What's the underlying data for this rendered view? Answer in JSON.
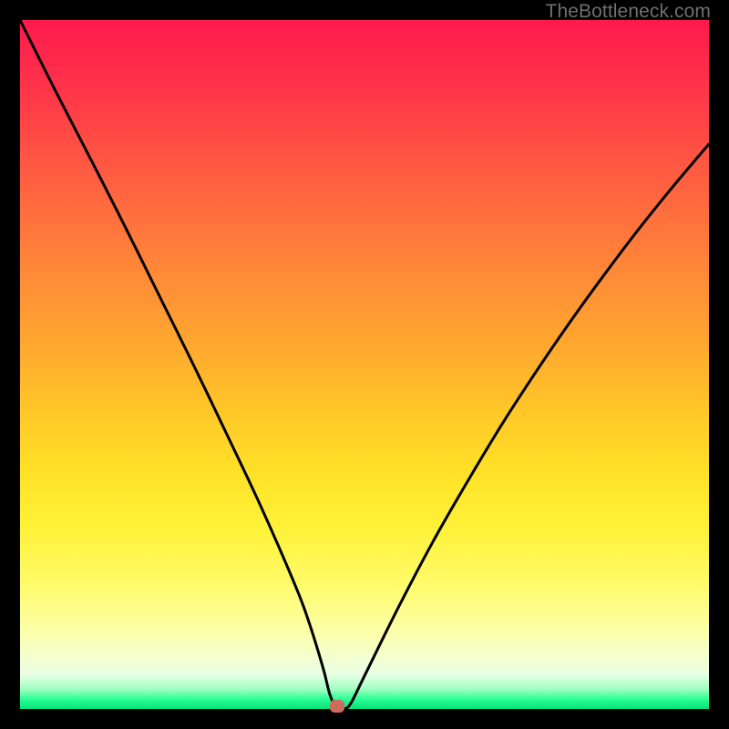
{
  "watermark": "TheBottleneck.com",
  "chart_data": {
    "type": "line",
    "title": "",
    "xlabel": "",
    "ylabel": "",
    "xlim": [
      0,
      100
    ],
    "ylim": [
      0,
      100
    ],
    "grid": false,
    "legend": false,
    "series": [
      {
        "name": "bottleneck-curve",
        "x": [
          0,
          5,
          10,
          15,
          20,
          25,
          30,
          35,
          40,
          42,
          44,
          45,
          46,
          47,
          48,
          50,
          55,
          60,
          65,
          70,
          75,
          80,
          85,
          90,
          95,
          100
        ],
        "values": [
          100,
          90,
          80.3,
          70.5,
          60.4,
          50.3,
          39.9,
          29.3,
          17.8,
          12.4,
          5.9,
          2.0,
          0.0,
          0.0,
          0.8,
          4.8,
          14.9,
          24.4,
          33.1,
          41.4,
          49.1,
          56.4,
          63.3,
          69.9,
          76.1,
          82.0
        ]
      }
    ],
    "annotations": [
      {
        "name": "min-marker",
        "x": 46,
        "y": 0,
        "color": "#cd6b5d"
      }
    ],
    "background": "rainbow-vertical"
  },
  "colors": {
    "curve_stroke": "#000000",
    "marker_fill": "#cd6b5d",
    "frame": "#000000",
    "watermark": "#6f6f6f"
  }
}
